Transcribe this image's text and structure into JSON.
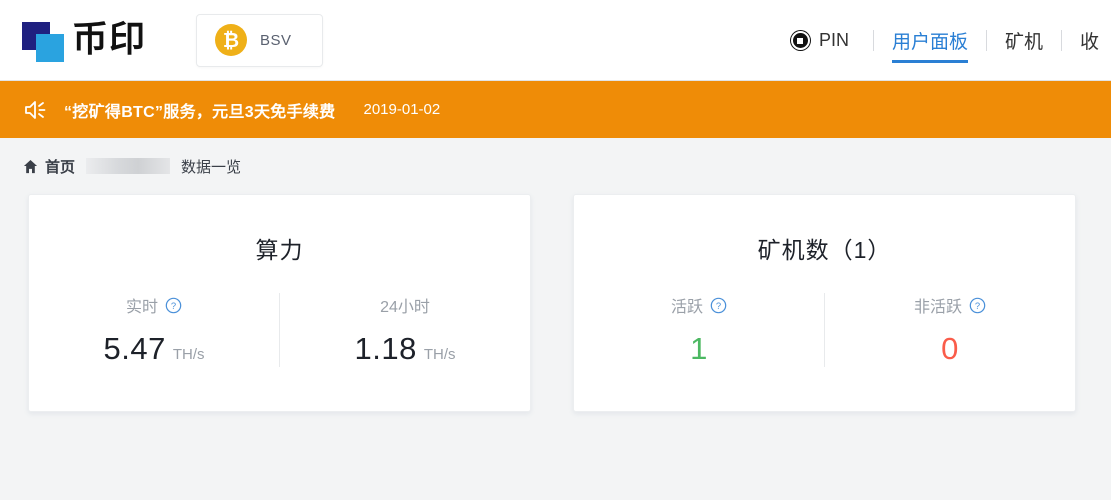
{
  "header": {
    "logo": {
      "text": "币印",
      "icon": "logo-squares-icon"
    },
    "coin_selector": {
      "symbol": "BSV",
      "coin_icon": "bitcoin-coin-icon"
    },
    "nav": {
      "pin": {
        "label": "PIN",
        "icon": "pin-circle-icon"
      },
      "items": [
        {
          "label": "用户面板",
          "active": true
        },
        {
          "label": "矿机",
          "active": false
        },
        {
          "label": "收",
          "active": false
        }
      ]
    }
  },
  "banner": {
    "icon": "speaker-icon",
    "text": "“挖矿得BTC”服务，元旦3天免手续费",
    "date": "2019-01-02",
    "color": "#ef8c07"
  },
  "breadcrumb": {
    "home_icon": "home-icon",
    "home_label": "首页",
    "redacted": "",
    "tail_label": "数据一览"
  },
  "cards": [
    {
      "title": "算力",
      "metrics": [
        {
          "label": "实时",
          "has_help": true,
          "value": "5.47",
          "unit": "TH/s",
          "color": "#1d2129"
        },
        {
          "label": "24小时",
          "has_help": false,
          "value": "1.18",
          "unit": "TH/s",
          "color": "#1d2129"
        }
      ]
    },
    {
      "title": "矿机数（1）",
      "metrics": [
        {
          "label": "活跃",
          "has_help": true,
          "value": "1",
          "unit": "",
          "color": "#4cb862"
        },
        {
          "label": "非活跃",
          "has_help": true,
          "value": "0",
          "unit": "",
          "color": "#fa5c4a"
        }
      ]
    }
  ]
}
